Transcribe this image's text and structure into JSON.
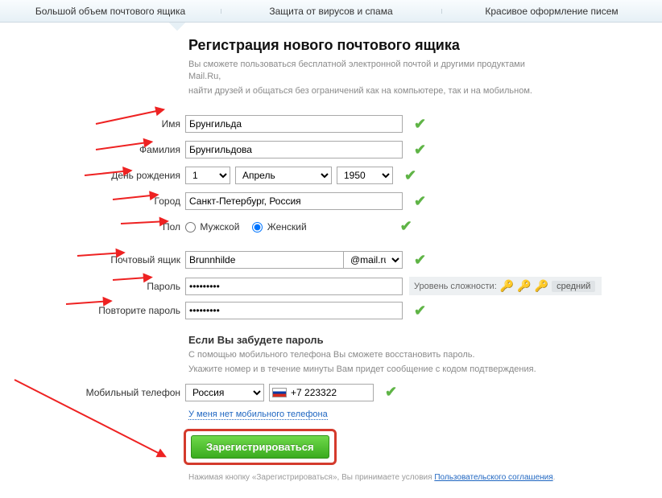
{
  "topbar": {
    "tab1": "Большой объем почтового ящика",
    "tab2": "Защита от вирусов и спама",
    "tab3": "Красивое оформление писем"
  },
  "heading": "Регистрация нового почтового ящика",
  "intro1": "Вы сможете пользоваться бесплатной электронной почтой и другими продуктами Mail.Ru,",
  "intro2": "найти друзей и общаться без ограничений как на компьютере, так и на мобильном.",
  "labels": {
    "first_name": "Имя",
    "last_name": "Фамилия",
    "dob": "День рождения",
    "city": "Город",
    "gender": "Пол",
    "mailbox": "Почтовый ящик",
    "password": "Пароль",
    "password2": "Повторите пароль",
    "phone": "Мобильный телефон"
  },
  "values": {
    "first_name": "Брунгильда",
    "last_name": "Брунгильдова",
    "day": "1",
    "month": "Апрель",
    "year": "1950",
    "city": "Санкт-Петербург, Россия",
    "gender_male": "Мужской",
    "gender_female": "Женский",
    "gender_selected": "female",
    "mailbox": "Brunnhilde",
    "domain": "@mail.ru",
    "password_mask": "•••••••••",
    "password2_mask": "•••••••••",
    "phone_country": "Россия",
    "phone_number": "+7 223322"
  },
  "strength": {
    "label": "Уровень сложности:",
    "value": "средний"
  },
  "forgot": {
    "head": "Если Вы забудете пароль",
    "line1": "С помощью мобильного телефона Вы сможете восстановить пароль.",
    "line2": "Укажите номер и в течение минуты Вам придет сообщение с кодом подтверждения."
  },
  "nophone_link": "У меня нет мобильного телефона",
  "register_btn": "Зарегистрироваться",
  "terms_prefix": "Нажимая кнопку «Зарегистрироваться», Вы принимаете условия ",
  "terms_link": "Пользовательского соглашения",
  "terms_suffix": "."
}
